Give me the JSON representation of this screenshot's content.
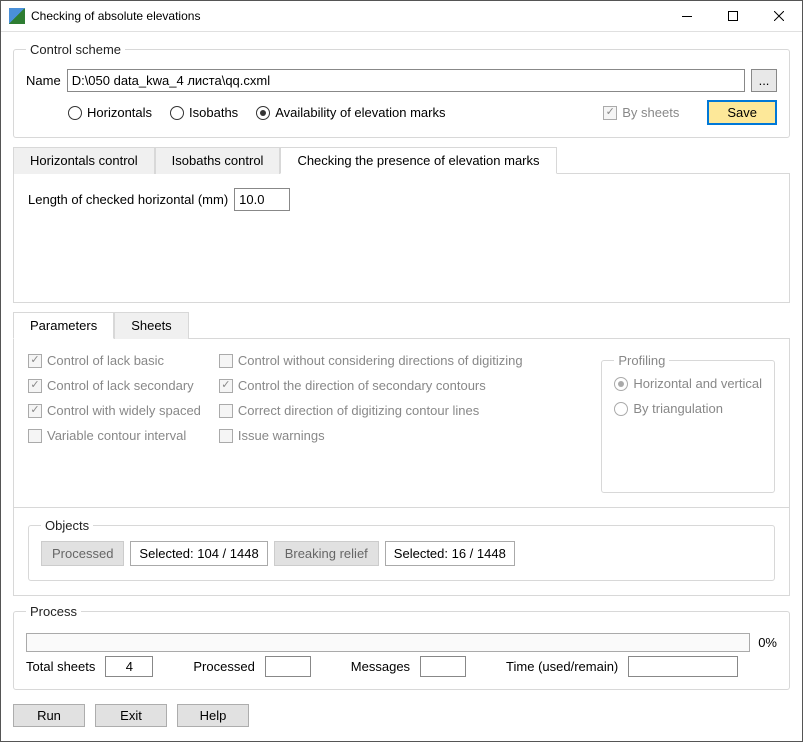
{
  "title": "Checking of absolute elevations",
  "controlScheme": {
    "legend": "Control scheme",
    "nameLabel": "Name",
    "nameValue": "D:\\050 data_kwa_4 листа\\qq.cxml",
    "radios": {
      "horizontals": "Horizontals",
      "isobaths": "Isobaths",
      "availability": "Availability of elevation marks"
    },
    "bySheets": "By sheets",
    "save": "Save"
  },
  "mainTabs": {
    "t1": "Horizontals control",
    "t2": "Isobaths control",
    "t3": "Checking the presence of elevation marks"
  },
  "lengthLabel": "Length of checked horizontal (mm)",
  "lengthValue": "10.0",
  "paramTabs": {
    "parameters": "Parameters",
    "sheets": "Sheets"
  },
  "checks": {
    "c1": "Control of lack basic",
    "c2": "Control of lack secondary",
    "c3": "Control with widely spaced",
    "c4": "Variable contour interval",
    "c5": "Control without considering directions of digitizing",
    "c6": "Control the direction of secondary contours",
    "c7": "Correct direction of digitizing contour lines",
    "c8": "Issue warnings"
  },
  "profiling": {
    "legend": "Profiling",
    "r1": "Horizontal and vertical",
    "r2": "By triangulation"
  },
  "objects": {
    "legend": "Objects",
    "processed": "Processed",
    "sel1": "Selected: 104 / 1448",
    "breaking": "Breaking relief",
    "sel2": "Selected: 16 / 1448"
  },
  "process": {
    "legend": "Process",
    "percent": "0%",
    "totalSheets": "Total sheets",
    "totalSheetsVal": "4",
    "processed": "Processed",
    "messages": "Messages",
    "time": "Time (used/remain)"
  },
  "buttons": {
    "run": "Run",
    "exit": "Exit",
    "help": "Help"
  }
}
